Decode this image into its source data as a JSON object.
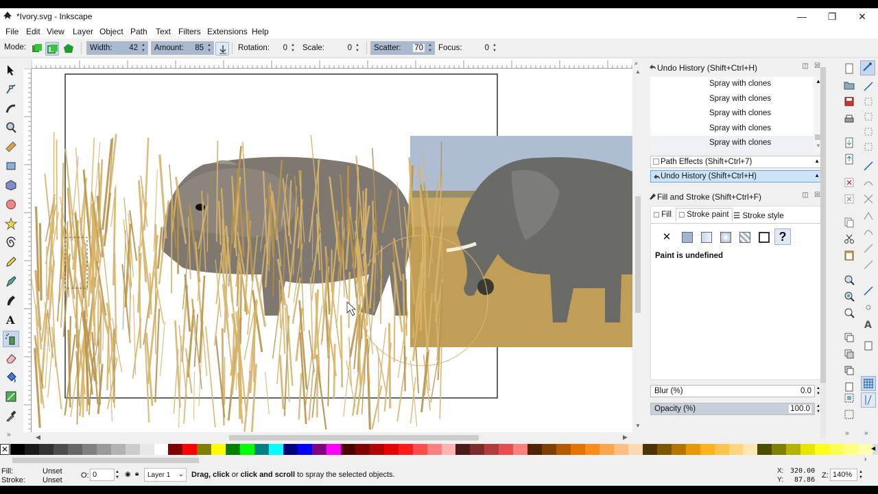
{
  "window": {
    "title": "*Ivory.svg - Inkscape"
  },
  "menu": [
    "File",
    "Edit",
    "View",
    "Layer",
    "Object",
    "Path",
    "Text",
    "Filters",
    "Extensions",
    "Help"
  ],
  "controls": {
    "mode_label": "Mode:",
    "width_label": "Width:",
    "width_value": "42",
    "amount_label": "Amount:",
    "amount_value": "85",
    "rotation_label": "Rotation:",
    "rotation_value": "0",
    "scale_label": "Scale:",
    "scale_value": "0",
    "scatter_label": "Scatter:",
    "scatter_value": "70",
    "focus_label": "Focus:",
    "focus_value": "0"
  },
  "undo_history": {
    "title": "Undo History (Shift+Ctrl+H)",
    "items": [
      "Spray with clones",
      "Spray with clones",
      "Spray with clones",
      "Spray with clones",
      "Spray with clones"
    ]
  },
  "path_effects": {
    "title": "Path Effects  (Shift+Ctrl+7)"
  },
  "undo_history_bar": {
    "title": "Undo History (Shift+Ctrl+H)"
  },
  "fill_stroke": {
    "title": "Fill and Stroke (Shift+Ctrl+F)",
    "tabs": [
      "Fill",
      "Stroke paint",
      "Stroke style"
    ],
    "paint_status": "Paint is undefined",
    "blur_label": "Blur (%)",
    "blur_value": "0.0",
    "opacity_label": "Opacity (%)",
    "opacity_value": "100.0"
  },
  "status": {
    "fill_label": "Fill:",
    "stroke_label": "Stroke:",
    "fill_value": "Unset",
    "stroke_value": "Unset",
    "opacity_label": "O:",
    "opacity_value": "0",
    "layer": "Layer 1",
    "message_bold1": "Drag, click",
    "message_mid1": " or ",
    "message_bold2": "click and scroll",
    "message_rest": " to spray the selected objects.",
    "x_label": "X:",
    "x_value": "320.00",
    "y_label": "Y:",
    "y_value": "87.86",
    "zoom_label": "Z:",
    "zoom_value": "140%"
  },
  "colors": {
    "selection_blue": "#cde3f7",
    "grass": "#d7b46a",
    "elephant_gray": "#807870"
  }
}
